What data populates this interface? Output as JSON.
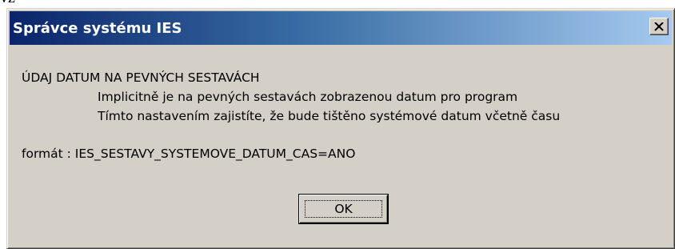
{
  "page_fragment": "vz",
  "dialog": {
    "title": "Správce systému IES",
    "close_icon": "close-icon",
    "message": {
      "heading": "ÚDAJ DATUM NA PEVNÝCH SESTAVÁCH",
      "line1": "Implicitně je na pevných sestavách zobrazenou datum pro program",
      "line2": "Tímto nastavením zajistíte, že bude tištěno systémové datum včetně času",
      "format": "formát : IES_SESTAVY_SYSTEMOVE_DATUM_CAS=ANO"
    },
    "ok_label": "OK"
  },
  "colors": {
    "title_start": "#0a246a",
    "title_end": "#a6caf0",
    "face": "#d4d0c8"
  }
}
